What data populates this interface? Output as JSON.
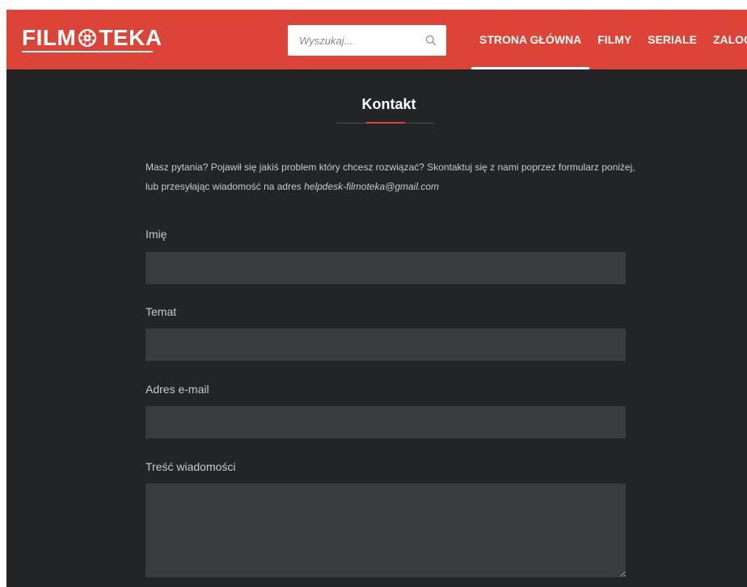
{
  "header": {
    "logo": "FILM TEKA",
    "logo_left": "FILM",
    "logo_right": "TEKA",
    "brand_color": "#db4437",
    "search": {
      "placeholder": "Wyszukaj...",
      "value": ""
    },
    "nav": [
      {
        "label": "STRONA GŁÓWNA",
        "active": true
      },
      {
        "label": "FILMY",
        "active": false
      },
      {
        "label": "SERIALE",
        "active": false
      },
      {
        "label": "ZALOGUJ",
        "active": false
      }
    ]
  },
  "main": {
    "title": "Kontakt",
    "intro_text": "Masz pytania? Pojawił się jakiś problem który chcesz rozwiązać? Skontaktuj się z nami poprzez formularz poniżej, lub przesyłając wiadomość na adres ",
    "intro_email": "helpdesk-filmoteka@gmail.com",
    "form": {
      "name_label": "Imię",
      "name_value": "",
      "subject_label": "Temat",
      "subject_value": "",
      "email_label": "Adres e-mail",
      "email_value": "",
      "message_label": "Treść wiadomości",
      "message_value": ""
    }
  },
  "icons": {
    "logo_icon": "film-reel-icon",
    "search_icon": "search-icon",
    "resize_icon": "resize-grip-icon"
  }
}
